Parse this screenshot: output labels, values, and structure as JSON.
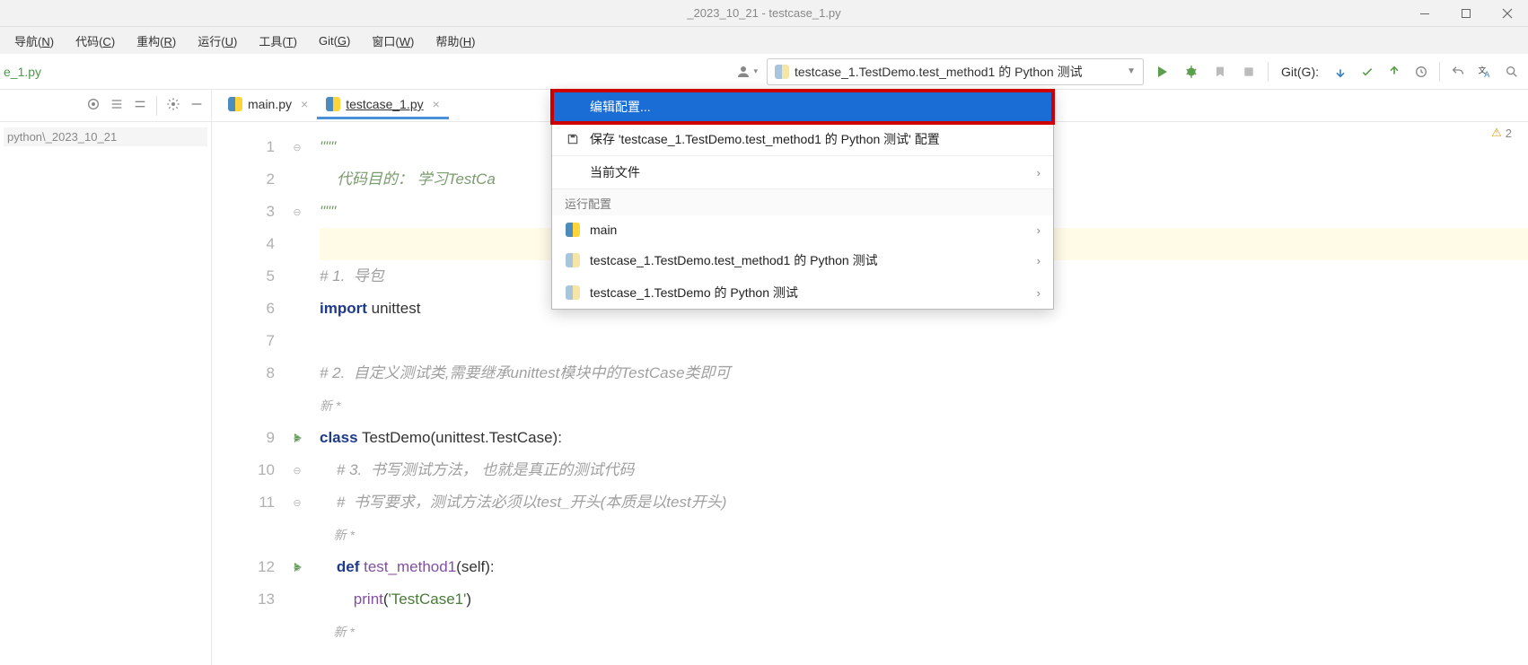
{
  "titlebar": {
    "center": "_2023_10_21 - testcase_1.py"
  },
  "menubar": [
    {
      "label": "导航",
      "accel": "N"
    },
    {
      "label": "代码",
      "accel": "C"
    },
    {
      "label": "重构",
      "accel": "R"
    },
    {
      "label": "运行",
      "accel": "U"
    },
    {
      "label": "工具",
      "accel": "T"
    },
    {
      "label": "Git",
      "accel": "G"
    },
    {
      "label": "窗口",
      "accel": "W"
    },
    {
      "label": "帮助",
      "accel": "H"
    }
  ],
  "breadcrumb_file": "e_1.py",
  "run_config": {
    "label": "testcase_1.TestDemo.test_method1 的 Python 测试"
  },
  "git_label": "Git(G):",
  "project_tree": {
    "path": "python\\_2023_10_21"
  },
  "editor_tabs": [
    {
      "label": "main.py",
      "active": false
    },
    {
      "label": "testcase_1.py",
      "active": true
    }
  ],
  "warnings": {
    "count": "2"
  },
  "code_lines": [
    {
      "n": 1,
      "type": "str",
      "text": "\"\"\""
    },
    {
      "n": 2,
      "type": "str",
      "text": "    代码目的： 学习TestCa"
    },
    {
      "n": 3,
      "type": "str",
      "text": "\"\"\""
    },
    {
      "n": 4,
      "type": "blank",
      "text": "",
      "highlight": true
    },
    {
      "n": 5,
      "type": "comment",
      "text": "# 1.  导包"
    },
    {
      "n": 6,
      "type": "import",
      "kw": "import",
      "rest": " unittest"
    },
    {
      "n": 7,
      "type": "blank",
      "text": ""
    },
    {
      "n": 8,
      "type": "comment",
      "text": "# 2.  自定义测试类,需要继承unittest模块中的TestCase类即可"
    },
    {
      "n": null,
      "type": "new",
      "text": "新 *"
    },
    {
      "n": 9,
      "type": "class",
      "kw": "class",
      "name": " TestDemo",
      "paren": "(unittest.TestCase):",
      "run": true
    },
    {
      "n": 10,
      "type": "comment",
      "text": "    # 3.  书写测试方法， 也就是真正的测试代码"
    },
    {
      "n": 11,
      "type": "comment",
      "text": "    #  书写要求，测试方法必须以test_开头(本质是以test开头)"
    },
    {
      "n": null,
      "type": "new",
      "text": "    新 *"
    },
    {
      "n": 12,
      "type": "def",
      "kw": "    def",
      "name": " test_method1",
      "paren": "(self):",
      "run": true
    },
    {
      "n": 13,
      "type": "print",
      "indent": "        ",
      "fn": "print",
      "arg": "'TestCase1'"
    },
    {
      "n": null,
      "type": "new",
      "text": "    新 *"
    }
  ],
  "dropdown": {
    "edit_config": "编辑配置...",
    "save_config": "保存 'testcase_1.TestDemo.test_method1 的 Python 测试' 配置",
    "current_file": "当前文件",
    "run_config_header": "运行配置",
    "items": [
      {
        "icon": "python",
        "label": "main"
      },
      {
        "icon": "python-faded",
        "label": "testcase_1.TestDemo.test_method1 的 Python 测试"
      },
      {
        "icon": "python-faded",
        "label": "testcase_1.TestDemo 的 Python 测试"
      }
    ]
  }
}
